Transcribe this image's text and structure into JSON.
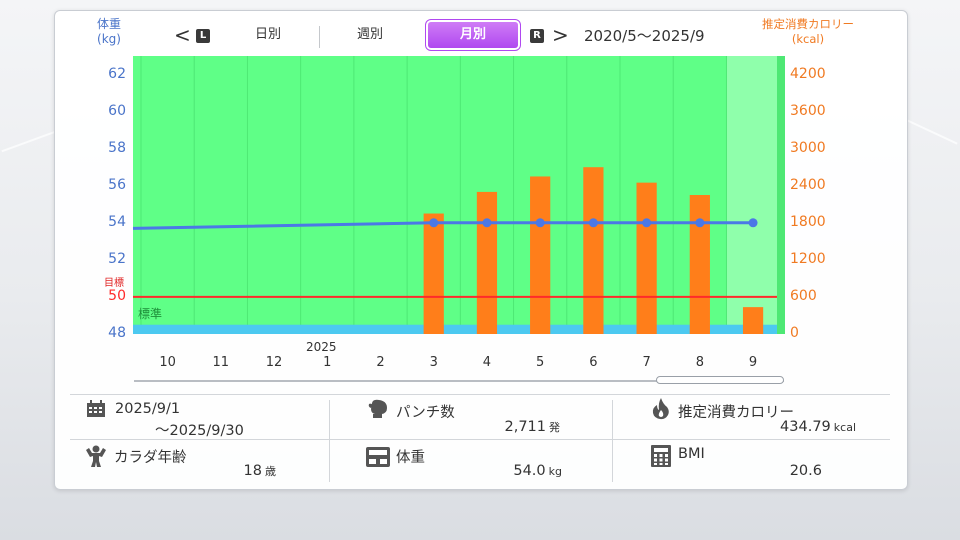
{
  "header": {
    "left_axis_title": "体重",
    "left_axis_unit": "(kg)",
    "right_axis_title": "推定消費カロリー",
    "right_axis_unit": "(kcal)",
    "prev_arrow": "<",
    "prev_key": "L",
    "next_key": "R",
    "next_arrow": ">",
    "tabs": [
      {
        "label": "日別",
        "active": false
      },
      {
        "label": "週別",
        "active": false
      },
      {
        "label": "月別",
        "active": true
      }
    ],
    "range": "2020/5〜2025/9"
  },
  "chart_data": {
    "type": "bar+line",
    "categories": [
      "10",
      "11",
      "12",
      "1",
      "2",
      "3",
      "4",
      "5",
      "6",
      "7",
      "8",
      "9"
    ],
    "year_marker": "2025",
    "left_axis": {
      "ticks": [
        "62",
        "60",
        "58",
        "56",
        "54",
        "52",
        "50",
        "48"
      ],
      "ylim": [
        48,
        63
      ]
    },
    "right_axis": {
      "ticks": [
        "4200",
        "3600",
        "3000",
        "2400",
        "1800",
        "1200",
        "600",
        "0"
      ],
      "ylim": [
        0,
        4500
      ]
    },
    "calories": [
      0,
      0,
      0,
      0,
      0,
      1950,
      2300,
      2550,
      2700,
      2450,
      2250,
      435
    ],
    "weight_trend_start": 53.7,
    "weight_points": [
      null,
      null,
      null,
      null,
      null,
      54.0,
      54.0,
      54.0,
      54.0,
      54.0,
      54.0,
      54.0
    ],
    "goal_label": "目標",
    "goal_value": 50,
    "standard_label": "標準",
    "standard_range": [
      48,
      48.5
    ]
  },
  "colors": {
    "plot_bg": "#5fff87",
    "bar": "#ff7e1a",
    "line": "#4b78e6",
    "goal": "#ff2a2a",
    "standard": "#4cc9f0",
    "tab_active": "#b048f0"
  },
  "summary": {
    "period_start": "2025/9/1",
    "period_end": "〜2025/9/30",
    "punch_label": "パンチ数",
    "punch_value": "2,711",
    "punch_unit": "発",
    "kcal_label": "推定消費カロリー",
    "kcal_value": "434.79",
    "kcal_unit": "kcal",
    "age_label": "カラダ年齢",
    "age_value": "18",
    "age_unit": "歳",
    "weight_label": "体重",
    "weight_value": "54.0",
    "weight_unit": "kg",
    "bmi_label": "BMI",
    "bmi_value": "20.6"
  },
  "icons": [
    "calendar-icon",
    "boxing-glove-icon",
    "flame-icon",
    "muscle-icon",
    "scale-icon",
    "calculator-icon"
  ]
}
